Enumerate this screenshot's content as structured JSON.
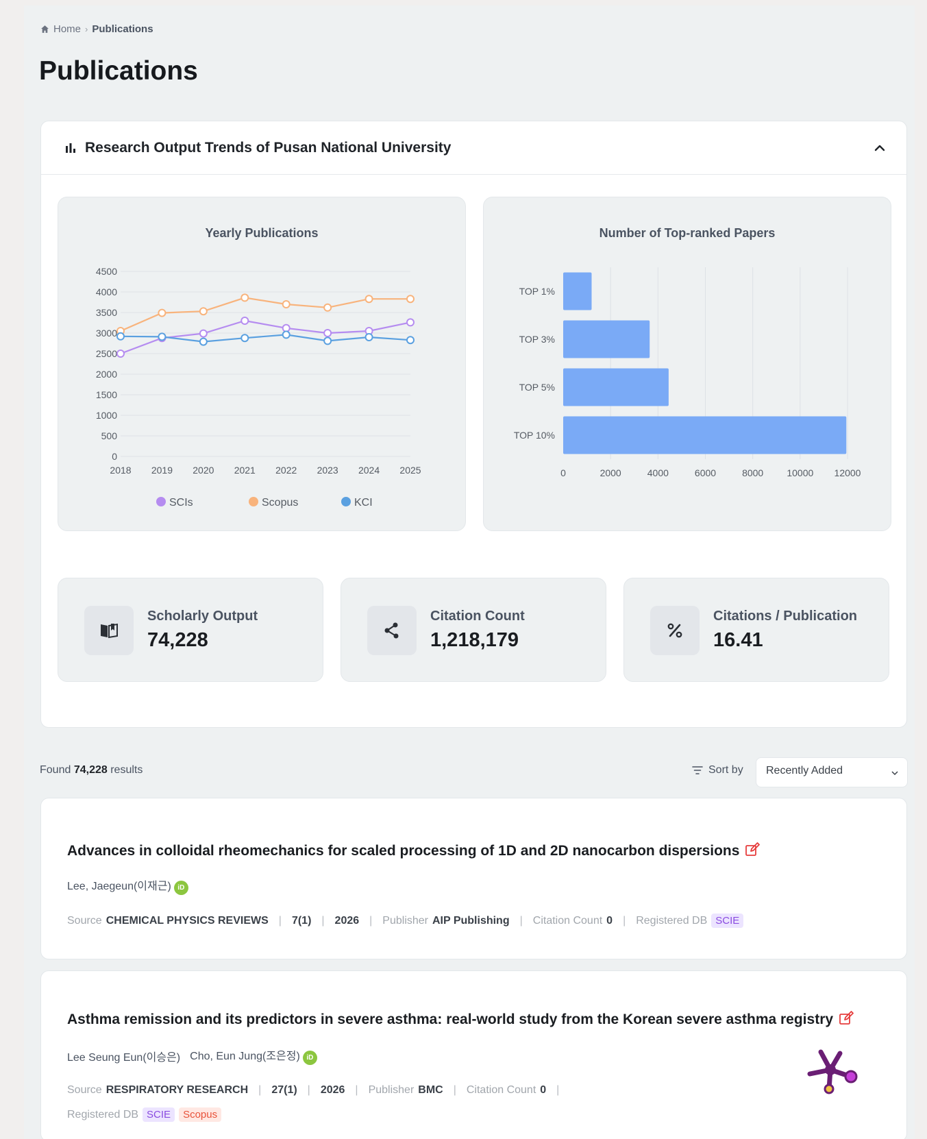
{
  "breadcrumb": {
    "home": "Home",
    "separator": "›",
    "current": "Publications"
  },
  "page_title": "Publications",
  "panel": {
    "title": "Research Output Trends of Pusan National University"
  },
  "chart_data": [
    {
      "type": "line",
      "title": "Yearly Publications",
      "x": [
        "2018",
        "2019",
        "2020",
        "2021",
        "2022",
        "2023",
        "2024",
        "2025"
      ],
      "ylim": [
        0,
        4500
      ],
      "yticks": [
        0,
        500,
        1000,
        1500,
        2000,
        2500,
        3000,
        3500,
        4000,
        4500
      ],
      "grid": true,
      "legend": "bottom",
      "series": [
        {
          "name": "SCIs",
          "color": "#b58cf0",
          "values": [
            2500,
            2880,
            2990,
            3300,
            3120,
            3000,
            3050,
            3260
          ]
        },
        {
          "name": "Scopus",
          "color": "#f8b37c",
          "values": [
            3050,
            3490,
            3530,
            3860,
            3700,
            3620,
            3830,
            3830
          ]
        },
        {
          "name": "KCI",
          "color": "#5aa0e0",
          "values": [
            2920,
            2910,
            2790,
            2880,
            2960,
            2810,
            2900,
            2830
          ]
        }
      ]
    },
    {
      "type": "bar",
      "orientation": "horizontal",
      "title": "Number of Top-ranked Papers",
      "categories": [
        "TOP 1%",
        "TOP 3%",
        "TOP 5%",
        "TOP 10%"
      ],
      "values": [
        1200,
        3650,
        4450,
        11950
      ],
      "xlim": [
        0,
        12000
      ],
      "xticks": [
        0,
        2000,
        4000,
        6000,
        8000,
        10000,
        12000
      ],
      "color": "#7aaaf6",
      "grid": true
    }
  ],
  "stats": [
    {
      "label": "Scholarly Output",
      "value": "74,228",
      "icon": "book-icon"
    },
    {
      "label": "Citation Count",
      "value": "1,218,179",
      "icon": "share-icon"
    },
    {
      "label": "Citations / Publication",
      "value": "16.41",
      "icon": "percent-icon"
    }
  ],
  "results": {
    "prefix": "Found",
    "count": "74,228",
    "suffix": "results"
  },
  "sort": {
    "label": "Sort by",
    "selected": "Recently Added"
  },
  "publications": [
    {
      "title": "Advances in colloidal rheomechanics for scaled processing of 1D and 2D nanocarbon dispersions",
      "authors": [
        "Lee, Jaegeun(이재근)"
      ],
      "orcid": "iD",
      "source_label": "Source",
      "source": "CHEMICAL PHYSICS REVIEWS",
      "volume": "7(1)",
      "year": "2026",
      "publisher_label": "Publisher",
      "publisher": "AIP Publishing",
      "citation_label": "Citation Count",
      "citation": "0",
      "db_label": "Registered DB",
      "dbs": [
        "SCIE"
      ]
    },
    {
      "title": "Asthma remission and its predictors in severe asthma: real-world study from the Korean severe asthma registry",
      "authors": [
        "Lee Seung Eun(이승은)",
        "Cho, Eun Jung(조은정)"
      ],
      "orcid": "iD",
      "source_label": "Source",
      "source": "RESPIRATORY RESEARCH",
      "volume": "27(1)",
      "year": "2026",
      "publisher_label": "Publisher",
      "publisher": "BMC",
      "citation_label": "Citation Count",
      "citation": "0",
      "db_label": "Registered DB",
      "dbs": [
        "SCIE",
        "Scopus"
      ]
    }
  ]
}
